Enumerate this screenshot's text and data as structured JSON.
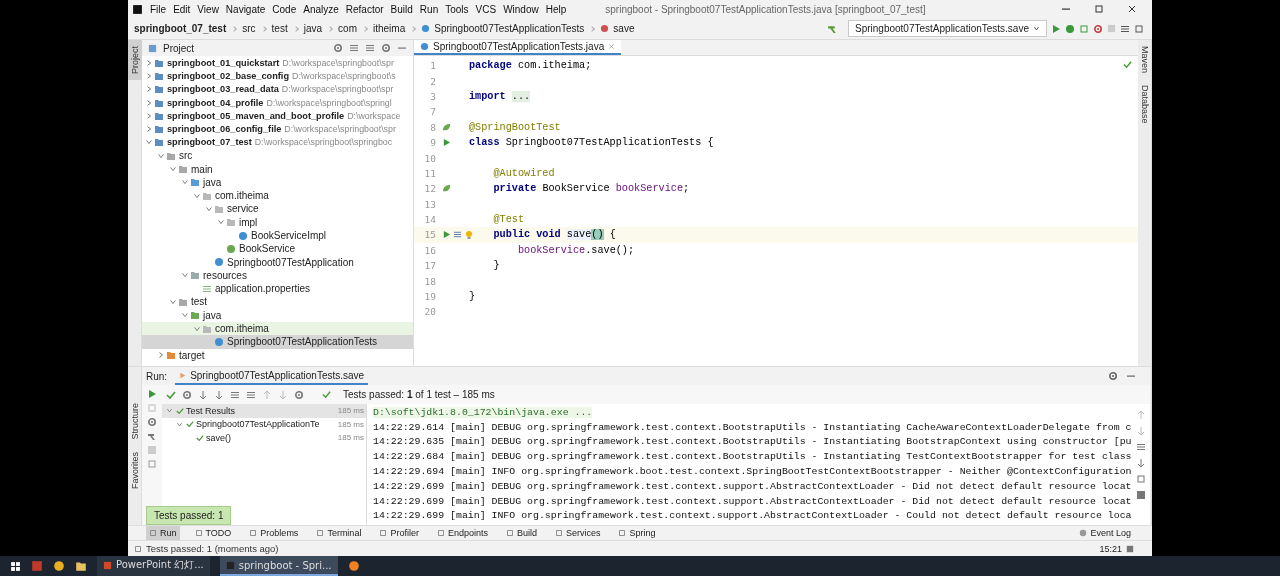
{
  "menu_bar": {
    "items": [
      "File",
      "Edit",
      "View",
      "Navigate",
      "Code",
      "Analyze",
      "Refactor",
      "Build",
      "Run",
      "Tools",
      "VCS",
      "Window",
      "Help"
    ],
    "window_title": "springboot - Springboot07TestApplicationTests.java [springboot_07_test]"
  },
  "nav_bar": {
    "crumbs": [
      "springboot_07_test",
      "src",
      "test",
      "java",
      "com",
      "itheima",
      "Springboot07TestApplicationTests",
      "save"
    ],
    "run_config": "Springboot07TestApplicationTests.save"
  },
  "left_strip": {
    "top": "Project",
    "bottom": [
      "Structure",
      "Favorites"
    ]
  },
  "right_strip": [
    "Maven",
    "Database"
  ],
  "project": {
    "title": "Project",
    "tree": [
      {
        "name": "springboot_01_quickstart",
        "path": "D:\\workspace\\springboot\\spr",
        "kind": "module",
        "expanded": false,
        "selected": false
      },
      {
        "name": "springboot_02_base_config",
        "path": "D:\\workspace\\springboot\\s",
        "kind": "module",
        "expanded": false,
        "selected": false
      },
      {
        "name": "springboot_03_read_data",
        "path": "D:\\workspace\\springboot\\spr",
        "kind": "module",
        "expanded": false,
        "selected": false
      },
      {
        "name": "springboot_04_profile",
        "path": "D:\\workspace\\springboot\\springl",
        "kind": "module",
        "expanded": false,
        "selected": false
      },
      {
        "name": "springboot_05_maven_and_boot_profile",
        "path": "D:\\workspace",
        "kind": "module",
        "expanded": false,
        "selected": false
      },
      {
        "name": "springboot_06_config_file",
        "path": "D:\\workspace\\springboot\\spr",
        "kind": "module",
        "expanded": false,
        "selected": false
      },
      {
        "name": "springboot_07_test",
        "path": "D:\\workspace\\springboot\\springboc",
        "kind": "module",
        "expanded": true,
        "selected": false,
        "children": [
          {
            "name": "src",
            "kind": "folder",
            "expanded": true,
            "selected": false,
            "children": [
              {
                "name": "main",
                "kind": "folder",
                "expanded": true,
                "selected": false,
                "children": [
                  {
                    "name": "java",
                    "kind": "source",
                    "expanded": true,
                    "selected": false,
                    "children": [
                      {
                        "name": "com.itheima",
                        "kind": "package",
                        "expanded": true,
                        "selected": false,
                        "children": [
                          {
                            "name": "service",
                            "kind": "package",
                            "expanded": true,
                            "selected": false,
                            "children": [
                              {
                                "name": "impl",
                                "kind": "package",
                                "expanded": true,
                                "selected": false,
                                "children": [
                                  {
                                    "name": "BookServiceImpl",
                                    "kind": "class",
                                    "selected": false
                                  }
                                ]
                              },
                              {
                                "name": "BookService",
                                "kind": "interface",
                                "selected": false
                              }
                            ]
                          },
                          {
                            "name": "Springboot07TestApplication",
                            "kind": "class",
                            "selected": false
                          }
                        ]
                      }
                    ]
                  },
                  {
                    "name": "resources",
                    "kind": "resources",
                    "expanded": true,
                    "selected": false,
                    "children": [
                      {
                        "name": "application.properties",
                        "kind": "properties",
                        "selected": false
                      }
                    ]
                  }
                ]
              },
              {
                "name": "test",
                "kind": "folder",
                "expanded": true,
                "selected": false,
                "children": [
                  {
                    "name": "java",
                    "kind": "test-source",
                    "expanded": true,
                    "selected": false,
                    "children": [
                      {
                        "name": "com.itheima",
                        "kind": "package",
                        "expanded": true,
                        "selected": false,
                        "test_scope": true,
                        "children": [
                          {
                            "name": "Springboot07TestApplicationTests",
                            "kind": "class",
                            "selected": true
                          }
                        ]
                      }
                    ]
                  }
                ]
              }
            ]
          },
          {
            "name": "target",
            "kind": "excluded",
            "expanded": false,
            "selected": false
          }
        ]
      }
    ]
  },
  "editor": {
    "tab": "Springboot07TestApplicationTests.java",
    "lines": [
      {
        "number": "1",
        "kind": "plain",
        "tokens": [
          {
            "kind": "keyword",
            "text": "package "
          },
          {
            "kind": "plain",
            "text": "com.itheima;"
          }
        ]
      },
      {
        "number": "2",
        "kind": "plain"
      },
      {
        "number": "3",
        "kind": "plain",
        "tokens": [
          {
            "kind": "keyword",
            "text": "import "
          },
          {
            "kind": "fold",
            "text": "..."
          }
        ]
      },
      {
        "number": "7",
        "kind": "plain"
      },
      {
        "number": "8",
        "kind": "bean",
        "tokens": [
          {
            "kind": "annotation",
            "text": "@SpringBootTest"
          }
        ]
      },
      {
        "number": "9",
        "kind": "run",
        "tokens": [
          {
            "kind": "keyword",
            "text": "class "
          },
          {
            "kind": "plain",
            "text": "Springboot07TestApplicationTests {"
          }
        ]
      },
      {
        "number": "10",
        "kind": "plain"
      },
      {
        "number": "11",
        "kind": "plain",
        "tokens": [
          {
            "kind": "annotation",
            "text": "    @Autowired"
          }
        ]
      },
      {
        "number": "12",
        "kind": "bean",
        "tokens": [
          {
            "kind": "keyword",
            "text": "    private "
          },
          {
            "kind": "plain",
            "text": "BookService "
          },
          {
            "kind": "field",
            "text": "bookService"
          },
          {
            "kind": "plain",
            "text": ";"
          }
        ]
      },
      {
        "number": "13",
        "kind": "plain"
      },
      {
        "number": "14",
        "kind": "plain",
        "tokens": [
          {
            "kind": "annotation",
            "text": "    @Test"
          }
        ]
      },
      {
        "number": "15",
        "kind": "run-profile",
        "current": true,
        "tokens": [
          {
            "kind": "keyword",
            "text": "    public void "
          },
          {
            "kind": "usage",
            "text": "save"
          },
          {
            "kind": "match",
            "text": "()"
          },
          {
            "kind": "plain",
            "text": " {"
          }
        ]
      },
      {
        "number": "16",
        "kind": "plain",
        "tokens": [
          {
            "kind": "field",
            "text": "        bookService"
          },
          {
            "kind": "plain",
            "text": ".save();"
          }
        ]
      },
      {
        "number": "17",
        "kind": "plain",
        "tokens": [
          {
            "kind": "plain",
            "text": "    }"
          }
        ]
      },
      {
        "number": "18",
        "kind": "plain"
      },
      {
        "number": "19",
        "kind": "plain",
        "tokens": [
          {
            "kind": "plain",
            "text": "}"
          }
        ]
      },
      {
        "number": "20",
        "kind": "plain"
      }
    ]
  },
  "run_panel": {
    "label": "Run:",
    "tab": "Springboot07TestApplicationTests.save",
    "status": "Tests passed: **1** of 1 test – 185 ms",
    "results": [
      {
        "name": "Test Results",
        "time": "185 ms",
        "passed": true,
        "expanded": true,
        "children": [
          {
            "name": "Springboot07TestApplicationTe",
            "time": "185 ms",
            "passed": true,
            "expanded": true,
            "children": [
              {
                "name": "save()",
                "time": "185 ms",
                "passed": true
              }
            ]
          }
        ]
      }
    ],
    "console": [
      {
        "kind": "command",
        "text": "D:\\soft\\jdk1.8.0_172\\bin\\java.exe ..."
      },
      {
        "kind": "log",
        "text": "14:22:29.614 [main] DEBUG org.springframework.test.context.BootstrapUtils - Instantiating CacheAwareContextLoaderDelegate from c"
      },
      {
        "kind": "log",
        "text": "14:22:29.635 [main] DEBUG org.springframework.test.context.BootstrapUtils - Instantiating BootstrapContext using constructor [pu"
      },
      {
        "kind": "log",
        "text": "14:22:29.684 [main] DEBUG org.springframework.test.context.BootstrapUtils - Instantiating TestContextBootstrapper for test class"
      },
      {
        "kind": "log",
        "text": "14:22:29.694 [main] INFO org.springframework.boot.test.context.SpringBootTestContextBootstrapper - Neither @ContextConfiguration"
      },
      {
        "kind": "log",
        "text": "14:22:29.699 [main] DEBUG org.springframework.test.context.support.AbstractContextLoader - Did not detect default resource locat"
      },
      {
        "kind": "log",
        "text": "14:22:29.699 [main] DEBUG org.springframework.test.context.support.AbstractContextLoader - Did not detect default resource locat"
      },
      {
        "kind": "log",
        "text": "14:22:29.699 [main] INFO org.springframework.test.context.support.AbstractContextLoader - Could not detect default resource loca"
      }
    ],
    "toast": "Tests passed: 1"
  },
  "tool_tabs": [
    {
      "label": "Run",
      "selected": true
    },
    {
      "label": "TODO",
      "selected": false
    },
    {
      "label": "Problems",
      "selected": false
    },
    {
      "label": "Terminal",
      "selected": false
    },
    {
      "label": "Profiler",
      "selected": false
    },
    {
      "label": "Endpoints",
      "selected": false
    },
    {
      "label": "Build",
      "selected": false
    },
    {
      "label": "Services",
      "selected": false
    },
    {
      "label": "Spring",
      "selected": false
    }
  ],
  "event_log": "Event Log",
  "status_bar": {
    "message": "Tests passed: 1 (moments ago)",
    "position": "15:21"
  },
  "taskbar": {
    "tasks": [
      {
        "label": "PowerPoint 幻灯...",
        "selected": false
      },
      {
        "label": "springboot - Spri...",
        "selected": true
      }
    ]
  }
}
